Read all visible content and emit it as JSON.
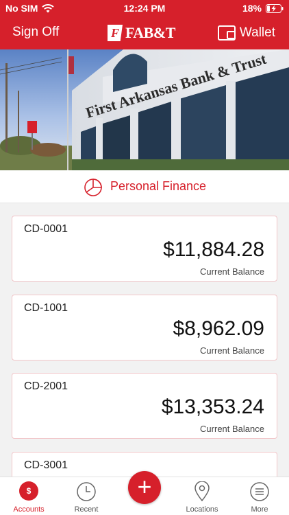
{
  "status_bar": {
    "carrier": "No SIM",
    "time": "12:24 PM",
    "battery": "18%"
  },
  "header": {
    "sign_off_label": "Sign Off",
    "logo_mark": "F",
    "logo_text": "FAB&T",
    "wallet_label": "Wallet"
  },
  "hero": {
    "building_sign": "First Arkansas Bank & Trust"
  },
  "section": {
    "title": "Personal Finance",
    "icon": "pie-chart-icon"
  },
  "accounts": [
    {
      "name": "CD-0001",
      "balance": "$11,884.28",
      "balance_label": "Current Balance"
    },
    {
      "name": "CD-1001",
      "balance": "$8,962.09",
      "balance_label": "Current Balance"
    },
    {
      "name": "CD-2001",
      "balance": "$13,353.24",
      "balance_label": "Current Balance"
    },
    {
      "name": "CD-3001",
      "balance": "",
      "balance_label": ""
    }
  ],
  "tabs": {
    "accounts": "Accounts",
    "accounts_icon_text": "$",
    "recent": "Recent",
    "add": "+",
    "locations": "Locations",
    "more": "More"
  },
  "colors": {
    "brand_red": "#d6202b",
    "card_border": "#f1c5c8"
  }
}
